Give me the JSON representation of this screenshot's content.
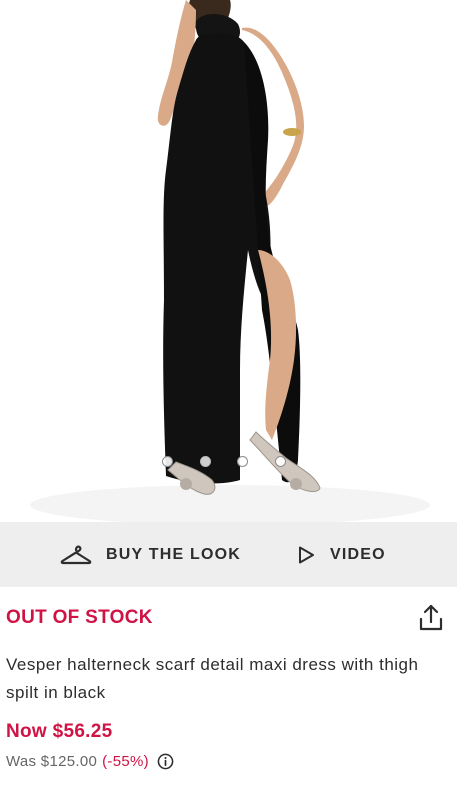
{
  "gallery": {
    "image_description_icon": "product-photo",
    "slide_count": 4,
    "active_slide": 2
  },
  "actions": {
    "buy_the_look": "BUY THE LOOK",
    "video": "VIDEO"
  },
  "product": {
    "stock_status": "OUT OF STOCK",
    "title": "Vesper halterneck scarf detail maxi dress with thigh spilt in black",
    "now_price": "Now $56.25",
    "was_price": "Was $125.00",
    "discount": "(-55%)"
  },
  "colors": {
    "accent": "#d01345",
    "bar": "#eeeeee",
    "text": "#2d2d2d"
  }
}
